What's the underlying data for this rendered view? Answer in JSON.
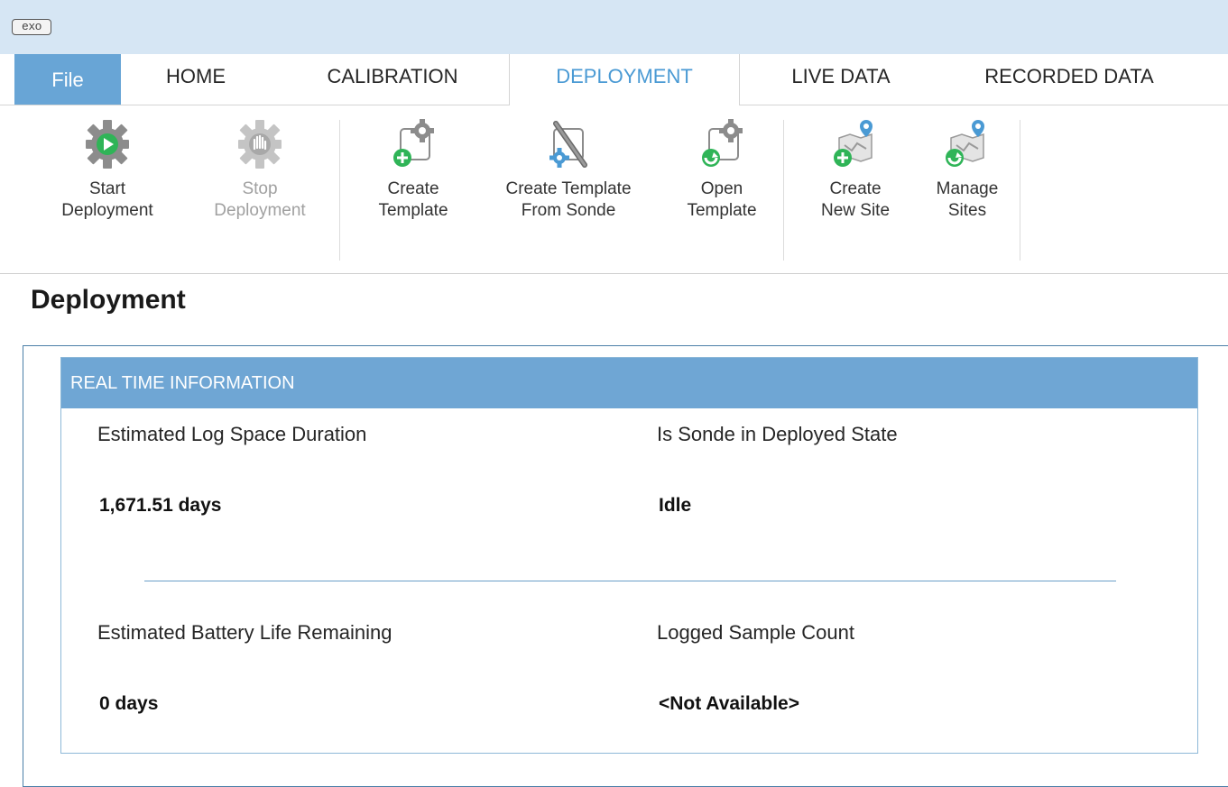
{
  "app": {
    "logo_text": "exo"
  },
  "tabs": [
    {
      "label": "File"
    },
    {
      "label": "HOME"
    },
    {
      "label": "CALIBRATION"
    },
    {
      "label": "DEPLOYMENT"
    },
    {
      "label": "LIVE DATA"
    },
    {
      "label": "RECORDED DATA"
    }
  ],
  "ribbon": {
    "buttons": [
      {
        "line1": "Start",
        "line2": "Deployment",
        "icon": "start-deployment-icon"
      },
      {
        "line1": "Stop",
        "line2": "Deployment",
        "icon": "stop-deployment-icon"
      },
      {
        "line1": "Create",
        "line2": "Template",
        "icon": "create-template-icon"
      },
      {
        "line1": "Create Template",
        "line2": "From Sonde",
        "icon": "create-template-from-sonde-icon"
      },
      {
        "line1": "Open",
        "line2": "Template",
        "icon": "open-template-icon"
      },
      {
        "line1": "Create",
        "line2": "New Site",
        "icon": "create-new-site-icon"
      },
      {
        "line1": "Manage",
        "line2": "Sites",
        "icon": "manage-sites-icon"
      }
    ]
  },
  "page": {
    "title": "Deployment"
  },
  "panel": {
    "title": "REAL TIME INFORMATION",
    "fields": [
      {
        "label": "Estimated Log Space Duration",
        "value": "1,671.51 days"
      },
      {
        "label": "Is Sonde in Deployed State",
        "value": "Idle"
      },
      {
        "label": "Estimated Battery Life Remaining",
        "value": "0 days"
      },
      {
        "label": "Logged Sample Count",
        "value": "<Not Available>"
      }
    ]
  },
  "colors": {
    "accent": "#68a5d6",
    "panel_header": "#6fa6d4",
    "active_tab_text": "#4a9ad4",
    "green": "#2fb457",
    "gear_gray": "#8c8c8c"
  }
}
